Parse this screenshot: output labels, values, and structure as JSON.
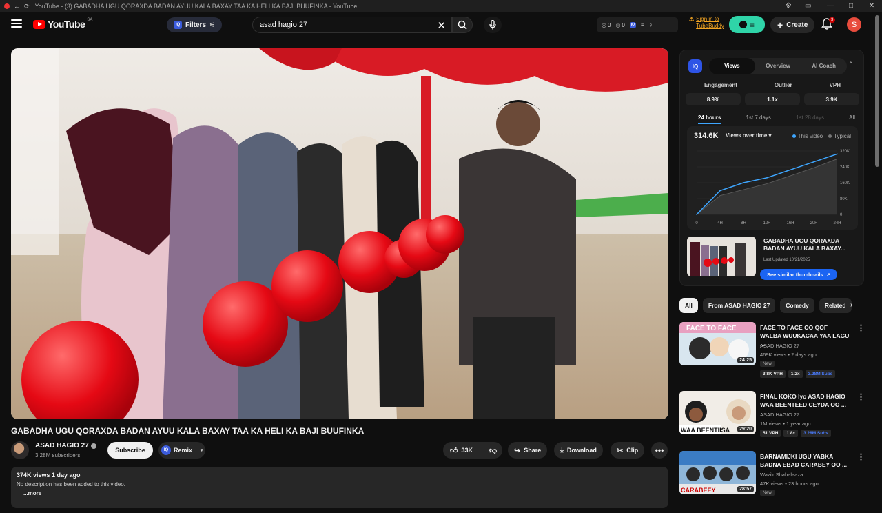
{
  "window": {
    "title": "YouTube - (3) GABADHA UGU QORAXDA BADAN AYUU KALA BAXAY TAA KA HELI KA BAJI BUUFINKA - YouTube",
    "controls": [
      "—",
      "□",
      "✕"
    ]
  },
  "header": {
    "logo_text": "YouTube",
    "country_code": "SA",
    "filters_label": "Filters",
    "search_value": "asad hagio 27",
    "stats": {
      "views": "0",
      "comments": "0"
    },
    "signin_text": "Sign in to TubeBuddy",
    "create_label": "Create",
    "notif_count": "3",
    "avatar_letter": "S"
  },
  "video": {
    "title": "GABADHA UGU QORAXDA BADAN AYUU KALA BAXAY TAA KA HELI KA BAJI BUUFINKA",
    "channel_name": "ASAD HAGIO 27",
    "subscribers": "3.28M subscribers",
    "subscribe_label": "Subscribe",
    "remix_label": "Remix",
    "likes": "33K",
    "share_label": "Share",
    "download_label": "Download",
    "clip_label": "Clip",
    "meta": "374K views  1 day ago",
    "description": "No description has been added to this video.",
    "more_label": "...more"
  },
  "iq": {
    "logo": "IQ",
    "tabs": [
      "Views",
      "Overview",
      "AI Coach"
    ],
    "metrics": [
      {
        "label": "Engagement",
        "value": "8.9%"
      },
      {
        "label": "Outlier",
        "value": "1.1x"
      },
      {
        "label": "VPH",
        "value": "3.9K"
      }
    ],
    "ranges": [
      "24 hours",
      "1st 7 days",
      "1st 28 days",
      "All"
    ],
    "total": "314.6K",
    "selector": "Views over time",
    "legend": [
      "This video",
      "Typical"
    ],
    "thumb_title": "GABADHA UGU QORAXDA BADAN AYUU KALA BAXAY...",
    "last_updated": "Last Updated 10/21/2025",
    "similar_label": "See similar thumbnails"
  },
  "chart_data": {
    "type": "area",
    "x": [
      "0",
      "4H",
      "8H",
      "12H",
      "16H",
      "20H",
      "24H"
    ],
    "yticks": [
      "320K",
      "240K",
      "160K",
      "80K",
      "0"
    ],
    "ylim": [
      0,
      320000
    ],
    "series": [
      {
        "name": "This video",
        "values": [
          0,
          120000,
          160000,
          185000,
          225000,
          265000,
          305000
        ]
      },
      {
        "name": "Typical",
        "values": [
          0,
          95000,
          125000,
          155000,
          195000,
          235000,
          280000
        ]
      }
    ],
    "colors": {
      "this_video": "#3ea6ff",
      "typical": "#5a5a5a"
    }
  },
  "chips": [
    "All",
    "From ASAD HAGIO 27",
    "Comedy",
    "Related"
  ],
  "recommendations": [
    {
      "title": "FACE TO FACE OO QOF WALBA WUUKACAA YAA LAGU ...",
      "channel": "ASAD HAGIO 27",
      "views": "469K views • 2 days ago",
      "tag": "New",
      "duration": "24:25",
      "vph": "3.8K VPH",
      "outlier": "1.2x",
      "subs": "3.28M Subs"
    },
    {
      "title": "FINAL KOKO Iyo ASAD HAGIO WAA BEENTEED CEYDA OO ...",
      "channel": "ASAD HAGIO 27",
      "views": "1M views • 1 year ago",
      "tag": "",
      "duration": "29:20",
      "vph": "51 VPH",
      "outlier": "1.8x",
      "subs": "3.28M Subs"
    },
    {
      "title": "BARNAMIJKI  UGU YABKA BADNA EBAD CARABEY OO ...",
      "channel": "Wazilr Shabalaaza",
      "views": "47K views • 23 hours ago",
      "tag": "New",
      "duration": "28:57",
      "vph": "",
      "outlier": "",
      "subs": ""
    }
  ]
}
